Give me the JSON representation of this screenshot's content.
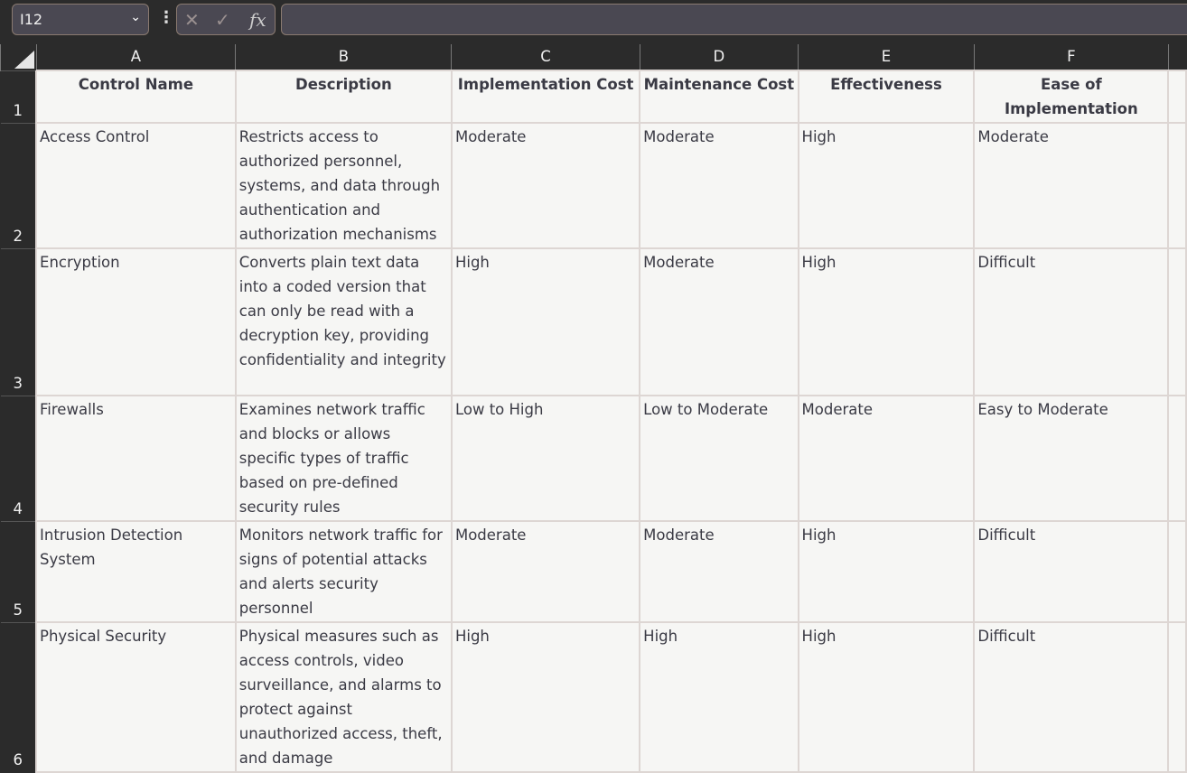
{
  "formula_bar": {
    "name_box": "I12",
    "formula": ""
  },
  "columns": [
    "A",
    "B",
    "C",
    "D",
    "E",
    "F"
  ],
  "rows": [
    "1",
    "2",
    "3",
    "4",
    "5",
    "6"
  ],
  "headers": [
    "Control Name",
    "Description",
    "Implementation Cost",
    "Maintenance Cost",
    "Effectiveness",
    "Ease of Implementation"
  ],
  "data": [
    [
      "Access Control",
      "Restricts access to authorized personnel, systems, and data through authentication and authorization mechanisms",
      "Moderate",
      "Moderate",
      "High",
      "Moderate"
    ],
    [
      "Encryption",
      "Converts plain text data into a coded version that can only be read with a decryption key, providing confidentiality and integrity",
      "High",
      "Moderate",
      "High",
      "Difficult"
    ],
    [
      "Firewalls",
      "Examines network traffic and blocks or allows specific types of traffic based on pre-defined security rules",
      "Low to High",
      "Low to Moderate",
      "Moderate",
      "Easy to Moderate"
    ],
    [
      "Intrusion Detection System",
      "Monitors network traffic for signs of potential attacks and alerts security personnel",
      "Moderate",
      "Moderate",
      "High",
      "Difficult"
    ],
    [
      "Physical Security",
      "Physical measures such as access controls, video surveillance, and alarms to protect against unauthorized access, theft, and damage",
      "High",
      "High",
      "High",
      "Difficult"
    ]
  ]
}
